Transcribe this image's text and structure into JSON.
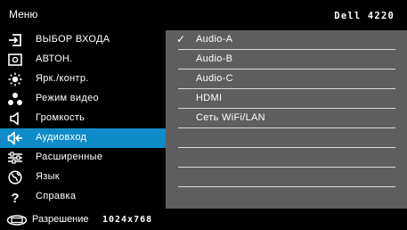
{
  "header": {
    "title": "Меню",
    "model": "Dell 4220"
  },
  "menu": {
    "items": [
      {
        "label": "ВЫБОР ВХОДА",
        "icon": "input-select-icon"
      },
      {
        "label": "АВТОН.",
        "icon": "auto-adjust-icon"
      },
      {
        "label": "Ярк./контр.",
        "icon": "brightness-icon"
      },
      {
        "label": "Режим видео",
        "icon": "video-mode-icon"
      },
      {
        "label": "Громкость",
        "icon": "volume-icon"
      },
      {
        "label": "Аудиовход",
        "icon": "audio-input-icon",
        "selected": true
      },
      {
        "label": "Расширенные",
        "icon": "advanced-settings-icon"
      },
      {
        "label": "Язык",
        "icon": "language-icon"
      },
      {
        "label": "Справка",
        "icon": "help-icon"
      }
    ]
  },
  "submenu": {
    "items": [
      {
        "label": "Audio-A",
        "checked": true
      },
      {
        "label": "Audio-B"
      },
      {
        "label": "Audio-C"
      },
      {
        "label": "HDMI"
      },
      {
        "label": "Сеть  WiFi/LAN"
      },
      {
        "label": ""
      },
      {
        "label": ""
      },
      {
        "label": ""
      },
      {
        "label": ""
      }
    ]
  },
  "footer": {
    "label": "Разрешение",
    "value": "1024x768",
    "icon": "display-resolution-icon"
  },
  "colors": {
    "selection": "#0e8bc8",
    "submenu_bg": "#5e5e5e",
    "background": "#000000"
  }
}
